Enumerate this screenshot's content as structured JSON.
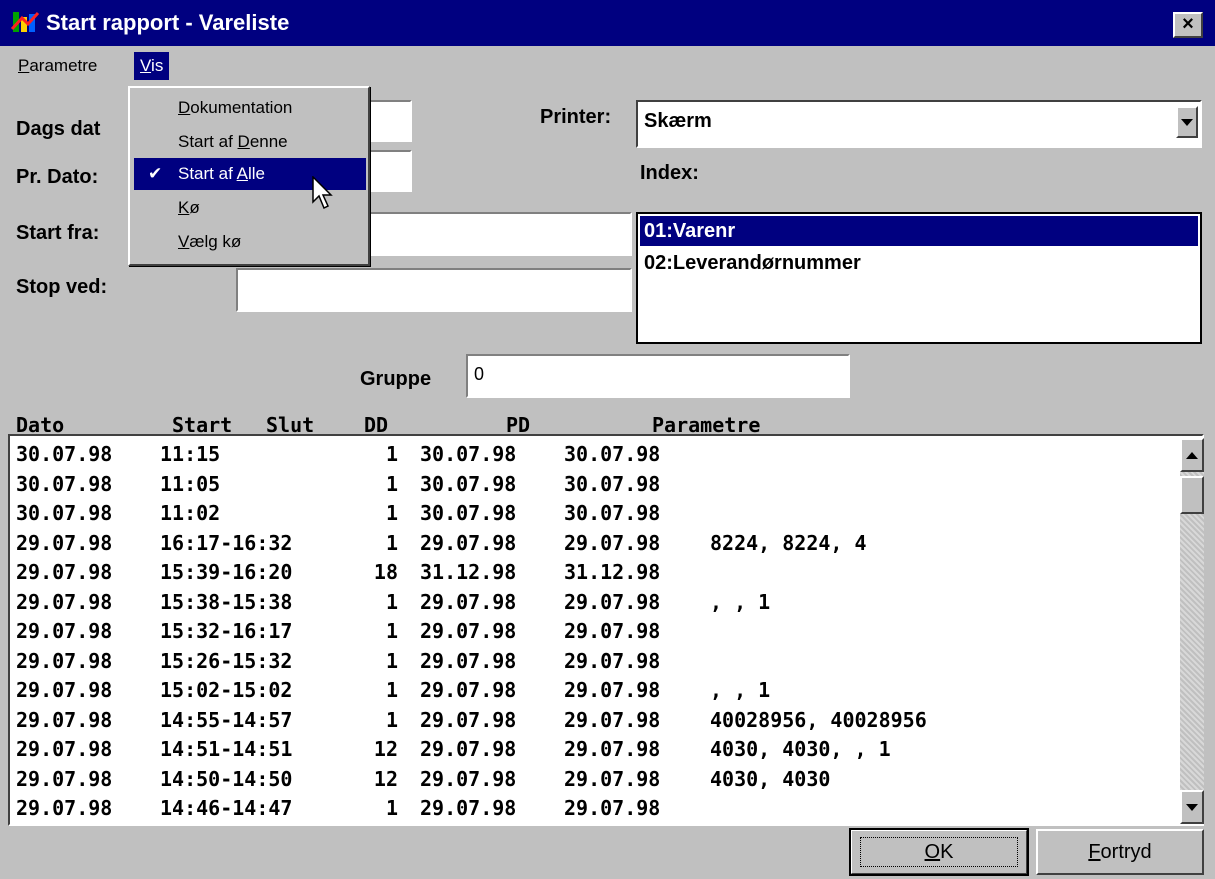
{
  "window": {
    "title": "Start rapport - Vareliste",
    "close": "×"
  },
  "menu": {
    "items": [
      {
        "label": "Parametre",
        "mnemonic": "P",
        "rest": "arametre"
      },
      {
        "label": "Vis",
        "mnemonic": "V",
        "rest": "is",
        "active": true
      }
    ]
  },
  "dropdown": {
    "items": [
      {
        "pre": "",
        "mnemonic": "D",
        "post": "okumentation",
        "label": "Dokumentation",
        "checked": false
      },
      {
        "pre": "Start af ",
        "mnemonic": "D",
        "post": "enne",
        "label": "Start af Denne",
        "checked": false
      },
      {
        "pre": "Start af ",
        "mnemonic": "A",
        "post": "lle",
        "label": "Start af Alle",
        "checked": true,
        "selected": true
      },
      {
        "pre": "",
        "mnemonic": "K",
        "post": "ø",
        "label": "Kø",
        "checked": false
      },
      {
        "pre": "",
        "mnemonic": "V",
        "post": "ælg kø",
        "label": "Vælg kø",
        "checked": false
      }
    ],
    "check_glyph": "✔"
  },
  "form": {
    "dags_dato_label": "Dags dat",
    "pr_dato_label": "Pr. Dato:",
    "start_fra_label": "Start fra:",
    "stop_ved_label": "Stop ved:",
    "printer_label": "Printer:",
    "printer_value": "Skærm",
    "index_label": "Index:",
    "gruppe_label": "Gruppe",
    "gruppe_value": "0"
  },
  "index": {
    "items": [
      "01:Varenr",
      "02:Leverandørnummer"
    ],
    "selected": 0
  },
  "log": {
    "headers": [
      "Dato",
      "Start",
      "Slut",
      "DD",
      "PD",
      "Parametre"
    ],
    "rows": [
      {
        "dato": "30.07.98",
        "tid": "11:15",
        "dd": "1",
        "pd": "30.07.98",
        "pd2": "30.07.98",
        "param": ""
      },
      {
        "dato": "30.07.98",
        "tid": "11:05",
        "dd": "1",
        "pd": "30.07.98",
        "pd2": "30.07.98",
        "param": ""
      },
      {
        "dato": "30.07.98",
        "tid": "11:02",
        "dd": "1",
        "pd": "30.07.98",
        "pd2": "30.07.98",
        "param": ""
      },
      {
        "dato": "29.07.98",
        "tid": "16:17-16:32",
        "dd": "1",
        "pd": "29.07.98",
        "pd2": "29.07.98",
        "param": "8224, 8224, 4"
      },
      {
        "dato": "29.07.98",
        "tid": "15:39-16:20",
        "dd": "18",
        "pd": "31.12.98",
        "pd2": "31.12.98",
        "param": ""
      },
      {
        "dato": "29.07.98",
        "tid": "15:38-15:38",
        "dd": "1",
        "pd": "29.07.98",
        "pd2": "29.07.98",
        "param": ", , 1"
      },
      {
        "dato": "29.07.98",
        "tid": "15:32-16:17",
        "dd": "1",
        "pd": "29.07.98",
        "pd2": "29.07.98",
        "param": ""
      },
      {
        "dato": "29.07.98",
        "tid": "15:26-15:32",
        "dd": "1",
        "pd": "29.07.98",
        "pd2": "29.07.98",
        "param": ""
      },
      {
        "dato": "29.07.98",
        "tid": "15:02-15:02",
        "dd": "1",
        "pd": "29.07.98",
        "pd2": "29.07.98",
        "param": ", , 1"
      },
      {
        "dato": "29.07.98",
        "tid": "14:55-14:57",
        "dd": "1",
        "pd": "29.07.98",
        "pd2": "29.07.98",
        "param": "40028956, 40028956"
      },
      {
        "dato": "29.07.98",
        "tid": "14:51-14:51",
        "dd": "12",
        "pd": "29.07.98",
        "pd2": "29.07.98",
        "param": "4030, 4030, , 1"
      },
      {
        "dato": "29.07.98",
        "tid": "14:50-14:50",
        "dd": "12",
        "pd": "29.07.98",
        "pd2": "29.07.98",
        "param": "4030, 4030"
      },
      {
        "dato": "29.07.98",
        "tid": "14:46-14:47",
        "dd": "1",
        "pd": "29.07.98",
        "pd2": "29.07.98",
        "param": ""
      }
    ]
  },
  "buttons": {
    "ok": {
      "mnemonic": "O",
      "rest": "K"
    },
    "cancel": {
      "mnemonic": "F",
      "rest": "ortryd"
    }
  },
  "colors": {
    "titlebar": "#000080",
    "face": "#c0c0c0",
    "selection": "#000080"
  }
}
